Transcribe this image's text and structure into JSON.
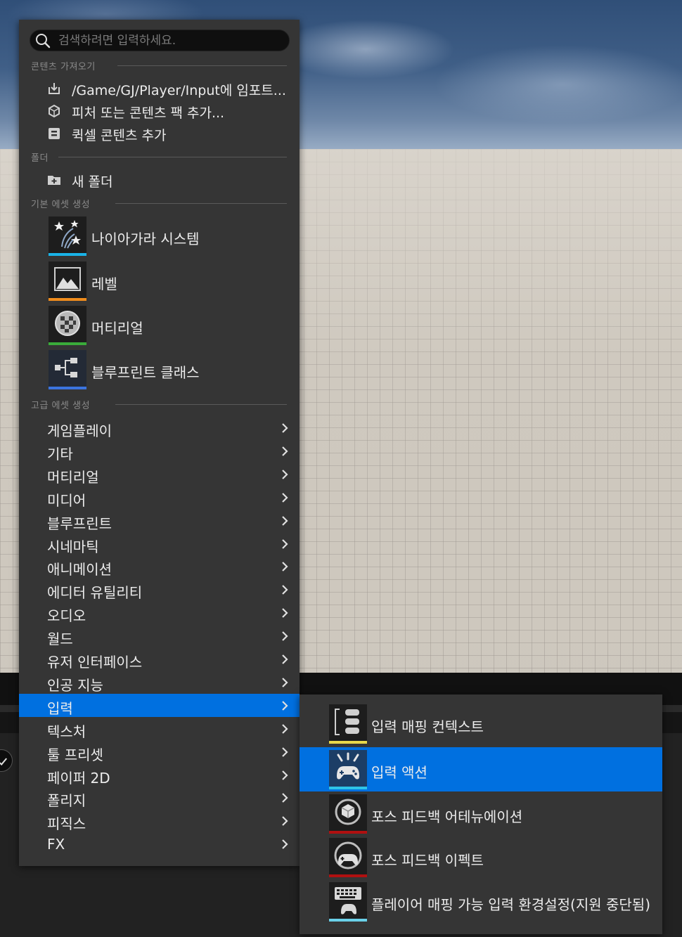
{
  "search": {
    "placeholder": "검색하려면 입력하세요."
  },
  "sections": {
    "import": "콘텐츠 가져오기",
    "folder": "폴더",
    "basic": "기본 에셋 생성",
    "advanced": "고급 에셋 생성"
  },
  "import_items": [
    {
      "label": "/Game/GJ/Player/Input에 임포트...",
      "icon": "import-icon"
    },
    {
      "label": "피처 또는 콘텐츠 팩 추가...",
      "icon": "content-pack-icon"
    },
    {
      "label": "퀵셀 콘텐츠 추가",
      "icon": "quixel-icon"
    }
  ],
  "folder_items": [
    {
      "label": "새 폴더",
      "icon": "new-folder-icon"
    }
  ],
  "basic_assets": [
    {
      "label": "나이아가라 시스템",
      "icon": "niagara-icon",
      "color": "#1ab3e8"
    },
    {
      "label": "레벨",
      "icon": "level-icon",
      "color": "#f08c1c"
    },
    {
      "label": "머티리얼",
      "icon": "material-icon",
      "color": "#3aab3a"
    },
    {
      "label": "블루프린트 클래스",
      "icon": "blueprint-icon",
      "color": "#3b74e0"
    }
  ],
  "categories": [
    {
      "label": "게임플레이"
    },
    {
      "label": "기타"
    },
    {
      "label": "머티리얼"
    },
    {
      "label": "미디어"
    },
    {
      "label": "블루프린트"
    },
    {
      "label": "시네마틱"
    },
    {
      "label": "애니메이션"
    },
    {
      "label": "에디터 유틸리티"
    },
    {
      "label": "오디오"
    },
    {
      "label": "월드"
    },
    {
      "label": "유저 인터페이스"
    },
    {
      "label": "인공 지능"
    },
    {
      "label": "입력",
      "active": true
    },
    {
      "label": "텍스처"
    },
    {
      "label": "툴 프리셋"
    },
    {
      "label": "페이퍼 2D"
    },
    {
      "label": "폴리지"
    },
    {
      "label": "피직스"
    },
    {
      "label": "FX"
    }
  ],
  "submenu": [
    {
      "label": "입력 매핑 컨텍스트",
      "icon": "input-mapping-context-icon",
      "color": "#e8d84a"
    },
    {
      "label": "입력 액션",
      "icon": "input-action-icon",
      "color": "#2ec4e8",
      "active": true
    },
    {
      "label": "포스 피드백 어테뉴에이션",
      "icon": "force-feedback-attenuation-icon",
      "color": "#b01010"
    },
    {
      "label": "포스 피드백 이펙트",
      "icon": "force-feedback-effect-icon",
      "color": "#b01010"
    },
    {
      "label": "플레이어 매핑 가능 입력 환경설정(지원 중단됨)",
      "icon": "player-mappable-input-icon",
      "color": "#6ad0e8"
    }
  ],
  "colors": {
    "accent": "#0070e0",
    "menu_bg": "#353535"
  }
}
